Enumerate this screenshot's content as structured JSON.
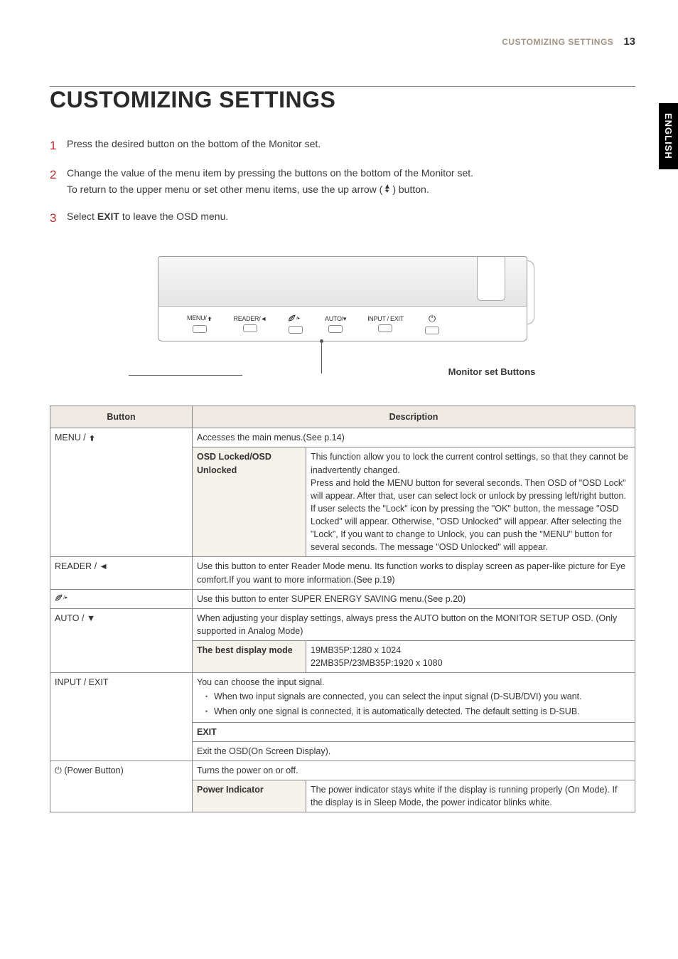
{
  "header": {
    "section": "CUSTOMIZING SETTINGS",
    "page": "13"
  },
  "lang_tab": "ENGLISH",
  "title": "CUSTOMIZING SETTINGS",
  "steps": [
    {
      "num": "1",
      "text": "Press the desired button on the bottom of the Monitor set."
    },
    {
      "num": "2",
      "text_a": "Change the value of the menu item by pressing the buttons on the bottom of the Monitor set.",
      "text_b_pre": "To return to the upper menu or set other menu items, use the up arrow (",
      "text_b_post": ") button."
    },
    {
      "num": "3",
      "text_pre": "Select ",
      "bold": "EXIT",
      "text_post": " to leave the OSD menu."
    }
  ],
  "diagram": {
    "buttons": [
      "MENU/",
      "READER/◄",
      "",
      "AUTO/▾",
      "INPUT / EXIT"
    ],
    "callout": "Monitor set Buttons"
  },
  "table": {
    "head": {
      "col1": "Button",
      "col2": "Description"
    },
    "rows": {
      "menu": {
        "label": "MENU / ",
        "desc": "Accesses the main menus.(See p.14)",
        "sub_label": "OSD Locked/OSD Unlocked",
        "sub_desc": "This function allow you to lock the current control settings, so that they cannot be inadvertently changed.\nPress and hold the MENU button for several seconds. Then OSD of \"OSD Lock\" will appear. After that, user can select lock or unlock by pressing left/right button.\nIf user selects the \"Lock\" icon by pressing the \"OK\" button, the message \"OSD Locked\" will appear. Otherwise, \"OSD Unlocked\" will appear. After selecting the \"Lock\", If you want to change to Unlock, you can push the \"MENU\" button for several seconds. The message \"OSD Unlocked\" will appear."
      },
      "reader": {
        "label": "READER / ◄",
        "desc": "Use this button to enter Reader Mode menu. Its function works to display screen as paper-like picture for Eye comfort.If you want to more information.(See p.19)"
      },
      "ez": {
        "desc": "Use this button to enter SUPER ENERGY SAVING menu.(See p.20)"
      },
      "auto": {
        "label": "AUTO / ▼",
        "desc": "When adjusting your display settings, always press the AUTO button on the MONITOR SETUP OSD. (Only supported in Analog Mode)",
        "sub_label": "The best display mode",
        "sub_desc": "19MB35P:1280 x 1024\n22MB35P/23MB35P:1920 x 1080"
      },
      "input": {
        "label": "INPUT / EXIT",
        "desc_intro": "You can choose the input signal.",
        "bullets": [
          "When two input signals are connected, you can select the input signal (D-SUB/DVI) you want.",
          "When only one signal is connected, it is automatically detected. The default setting is D-SUB."
        ],
        "exit_h": "EXIT",
        "exit_desc": "Exit the OSD(On Screen Display)."
      },
      "power": {
        "label": " (Power Button)",
        "desc": "Turns the power on or off.",
        "sub_label": "Power Indicator",
        "sub_desc": "The power indicator stays white if the display is running properly (On Mode). If the display is in Sleep Mode, the power indicator blinks white."
      }
    }
  }
}
